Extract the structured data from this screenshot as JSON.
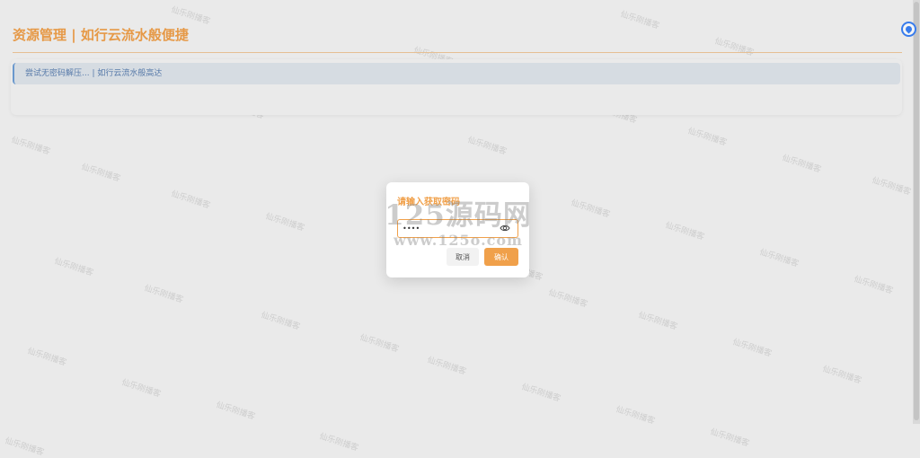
{
  "header": {
    "title": "资源管理 | 如行云流水般便捷"
  },
  "notice": {
    "text": "尝试无密码解压... | 如行云流水般高达"
  },
  "modal": {
    "title": "请输入获取密码",
    "password_value": "••••",
    "cancel_label": "取消",
    "confirm_label": "确认"
  },
  "site_watermark": {
    "line1": "125源码网",
    "line2": "www.125o.com"
  },
  "background_watermark": {
    "text": "仙乐刚播客"
  },
  "colors": {
    "accent": "#f0a04a",
    "notice_text": "#5b7fb0",
    "notice_bg": "#dfe5ec",
    "float_button": "#3b82f6"
  }
}
